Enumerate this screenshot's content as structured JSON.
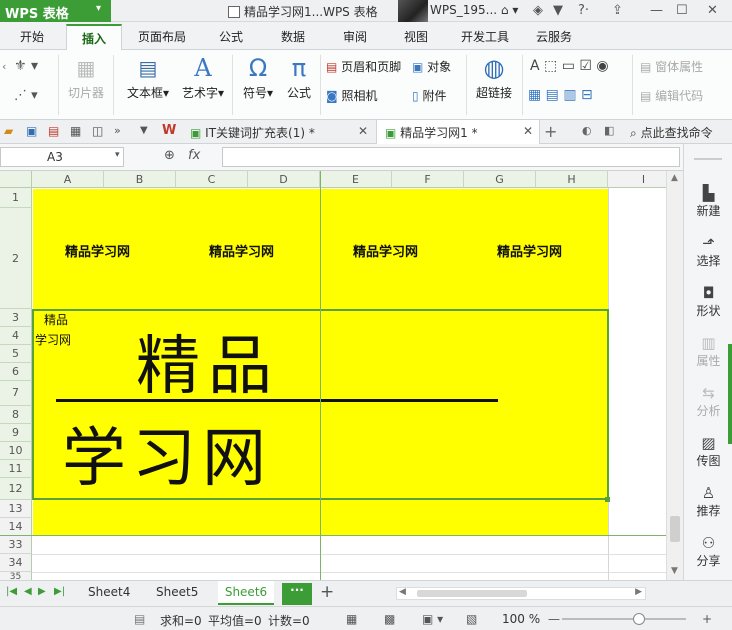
{
  "titlebar": {
    "app_name": "WPS 表格",
    "doc_title": "精品学习网1...WPS 表格",
    "user_name": "WPS_195...",
    "accent": "#3c9d36"
  },
  "menu": {
    "tabs": [
      "开始",
      "插入",
      "页面布局",
      "公式",
      "数据",
      "审阅",
      "视图",
      "开发工具",
      "云服务"
    ],
    "active": "插入"
  },
  "ribbon": {
    "slice": "切片器",
    "textbox": "文本框",
    "wordart": "艺术字",
    "symbol": "符号",
    "formula": "公式",
    "header_footer": "页眉和页脚",
    "object": "对象",
    "camera": "照相机",
    "attachment": "附件",
    "hyperlink": "超链接",
    "form_props": "窗体属性",
    "edit_code": "编辑代码"
  },
  "doc_tabs": {
    "tab1": "IT关键词扩充表(1) *",
    "tab2": "精品学习网1 *",
    "search": "点此查找命令"
  },
  "formula_bar": {
    "cell_ref": "A3",
    "fx": "fx",
    "value": ""
  },
  "grid": {
    "columns": [
      "A",
      "B",
      "C",
      "D",
      "E",
      "F",
      "G",
      "H",
      "I"
    ],
    "rows": [
      "1",
      "2",
      "3",
      "4",
      "5",
      "6",
      "7",
      "8",
      "9",
      "10",
      "11",
      "12",
      "13",
      "14",
      "33",
      "34",
      "35"
    ],
    "header_text": "精品学习网",
    "small_text_line1": "精品",
    "small_text_line2": "学习网",
    "big_text_line1": "精品",
    "big_text_line2": "学习网",
    "fill_color": "#ffff00"
  },
  "right_panel": {
    "items": [
      "新建",
      "选择",
      "形状",
      "属性",
      "分析",
      "传图",
      "推荐",
      "分享"
    ]
  },
  "sheet_tabs": {
    "tabs": [
      "Sheet4",
      "Sheet5",
      "Sheet6"
    ],
    "active": "Sheet6",
    "more": "···",
    "add": "+"
  },
  "status": {
    "sum": "求和=0",
    "avg": "平均值=0",
    "count": "计数=0",
    "zoom": "100 %",
    "zoom_level": 0.62
  }
}
